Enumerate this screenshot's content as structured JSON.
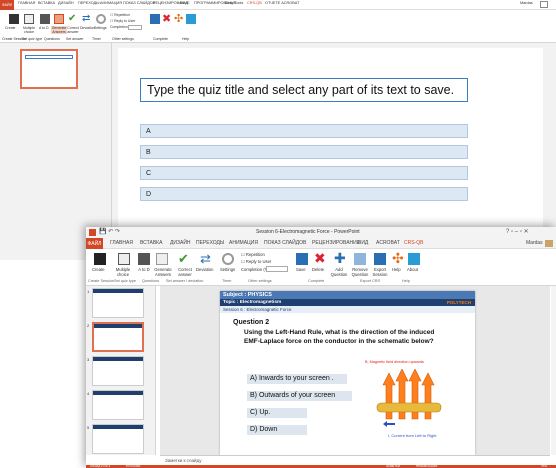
{
  "back": {
    "file_tab": "ФАЙЛ",
    "tabs": [
      "ГЛАВНАЯ",
      "ВСТАВКА",
      "ДИЗАЙН",
      "ПЕРЕХОДЫ",
      "АНИМАЦИЯ",
      "ПОКАЗ СЛАЙДОВ",
      "РЕЦЕНЗИРОВАНИЕ",
      "ВИД",
      "ПРОГРАММИРОВАНИЕ",
      "Easy Tools",
      "CRS-QB",
      "ОТЧЕТЕ ACROBAT"
    ],
    "user": "Mardas",
    "ribbon_buttons": [
      "Create",
      "Multiple choice",
      "A to D",
      "Generate Answers",
      "Correct answer",
      "Deviation",
      "Settings"
    ],
    "checkbox_repetition": "Repetition",
    "checkbox_reply": "Reply to User",
    "completion": "Completion (%)",
    "group_labels": [
      "Create Session",
      "Set quiz type",
      "Questions",
      "Set answer",
      "Timer",
      "Other settings",
      "Complete",
      "Help"
    ],
    "quiz_title_placeholder": "Type the quiz title and select any part of its text to save.",
    "answers": [
      "A",
      "B",
      "C",
      "D"
    ]
  },
  "front": {
    "title": "Session 6-Electromagnetic Force - PowerPoint",
    "file_tab": "ФАЙЛ",
    "tabs": [
      "ГЛАВНАЯ",
      "ВСТАВКА",
      "ДИЗАЙН",
      "ПЕРЕХОДЫ",
      "АНИМАЦИЯ",
      "ПОКАЗ СЛАЙДОВ",
      "РЕЦЕНЗИРОВАНИЕ",
      "ВИД",
      "ACROBAT",
      "CRS-QB"
    ],
    "user": "Mardas",
    "ribbon": {
      "create": "Create",
      "multiple_choice": "Multiple choice",
      "a_to_d": "A to D",
      "generate_answers": "Generate Answers",
      "correct_answer": "Correct answer",
      "deviation": "Deviation",
      "settings": "Settings",
      "repetition": "Repetition",
      "reply": "Reply to User",
      "completion": "Completion (%)",
      "save": "Save",
      "delete": "Delete",
      "add_question": "Add Question",
      "remove_question": "Remove Question",
      "export_session": "Export Session",
      "help": "Help",
      "about": "About"
    },
    "groups": [
      "Create Session",
      "Set quiz type",
      "Questions",
      "Set answer / deviation",
      "Timer",
      "Other settings",
      "Complete",
      "Export CRS",
      "Help"
    ],
    "slide_numbers": [
      "1",
      "2",
      "3",
      "4",
      "5"
    ],
    "slide": {
      "subject": "Subject : PHYSICS",
      "topic": "Topic : Electromagnetism",
      "brand": "POLYTECH",
      "session": "Session 6 : Electromagnetic Force",
      "question_title": "Question 2",
      "question_text": "Using the Left-Hand Rule, what is the direction of the induced EMF-Laplace force on the conductor in the schematic below?",
      "answers": [
        "A) Inwards to your screen .",
        "B) Outwards of your screen",
        "C) Up.",
        "D) Down"
      ],
      "mag_label": "B, Magnetic field direction upwards",
      "current_label": "I, Current from Left to Right"
    },
    "notes_placeholder": "Заметки к слайду",
    "status_left": "СЛАЙД 2 ИЗ 4",
    "status_lang": "РУССКИЙ",
    "status_notes": "ЗАМЕТКИ",
    "status_comments": "ПРИМЕЧАНИЯ",
    "zoom": "70%"
  },
  "colors": {
    "accent": "#d24726",
    "blue": "#4a79b5",
    "navy": "#1f3f6f",
    "orange": "#ff7a00"
  }
}
